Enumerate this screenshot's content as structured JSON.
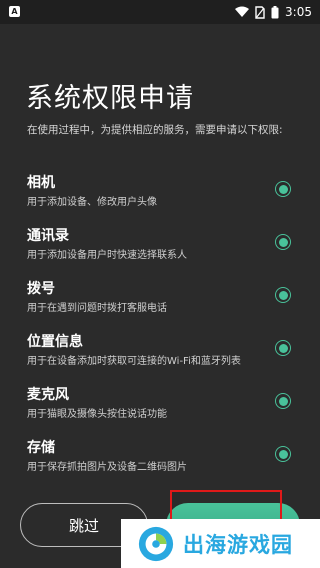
{
  "status_bar": {
    "left_icon_letter": "A",
    "time": "3:05",
    "icons": [
      "wifi-icon",
      "sim-icon",
      "battery-icon"
    ]
  },
  "title": "系统权限申请",
  "subtitle": "在使用过程中，为提供相应的服务，需要申请以下权限:",
  "permissions": [
    {
      "name": "相机",
      "desc": "用于添加设备、修改用户头像"
    },
    {
      "name": "通讯录",
      "desc": "用于添加设备用户时快速选择联系人"
    },
    {
      "name": "拨号",
      "desc": "用于在遇到问题时拨打客服电话"
    },
    {
      "name": "位置信息",
      "desc": "用于在设备添加时获取可连接的Wi-Fi和蓝牙列表"
    },
    {
      "name": "麦克风",
      "desc": "用于猫眼及摄像头按住说话功能"
    },
    {
      "name": "存储",
      "desc": "用于保存抓拍图片及设备二维码图片"
    }
  ],
  "buttons": {
    "skip": "跳过"
  },
  "watermark": {
    "text": "出海游戏园"
  },
  "colors": {
    "background": "#2b2b2b",
    "accent": "#49c29a",
    "highlight": "#e01919",
    "watermark_text": "#29a8e0"
  }
}
